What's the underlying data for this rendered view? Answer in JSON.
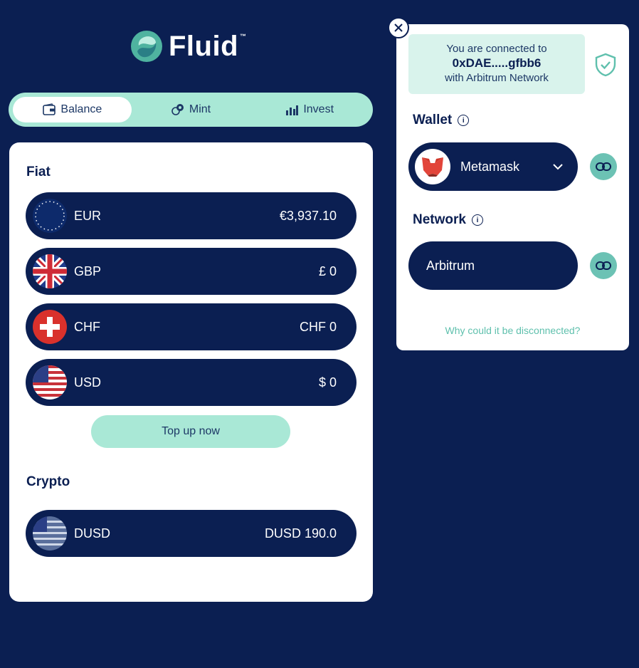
{
  "brand": {
    "name": "Fluid",
    "trademark": "™"
  },
  "tabs": [
    {
      "label": "Balance",
      "icon": "wallet-icon",
      "active": true
    },
    {
      "label": "Mint",
      "icon": "coins-icon",
      "active": false
    },
    {
      "label": "Invest",
      "icon": "chart-icon",
      "active": false
    }
  ],
  "fiat": {
    "title": "Fiat",
    "rows": [
      {
        "code": "EUR",
        "amount": "€3,937.10",
        "flag": "eu-flag-icon"
      },
      {
        "code": "GBP",
        "amount": "£ 0",
        "flag": "uk-flag-icon"
      },
      {
        "code": "CHF",
        "amount": "CHF 0",
        "flag": "swiss-flag-icon"
      },
      {
        "code": "USD",
        "amount": "$ 0",
        "flag": "us-flag-icon"
      }
    ],
    "topup_label": "Top up now"
  },
  "crypto": {
    "title": "Crypto",
    "rows": [
      {
        "code": "DUSD",
        "amount": "DUSD 190.0",
        "flag": "dusd-flag-icon"
      }
    ]
  },
  "connection": {
    "line1": "You are connected to",
    "address": "0xDAE.....gfbb6",
    "line3": "with Arbitrum Network",
    "wallet_label": "Wallet",
    "wallet_name": "Metamask",
    "network_label": "Network",
    "network_name": "Arbitrum",
    "why_link": "Why could it be disconnected?"
  },
  "colors": {
    "background": "#0b1f52",
    "mint": "#a9e8d6",
    "teal": "#6cc2b4",
    "link": "#5fc0ad"
  }
}
